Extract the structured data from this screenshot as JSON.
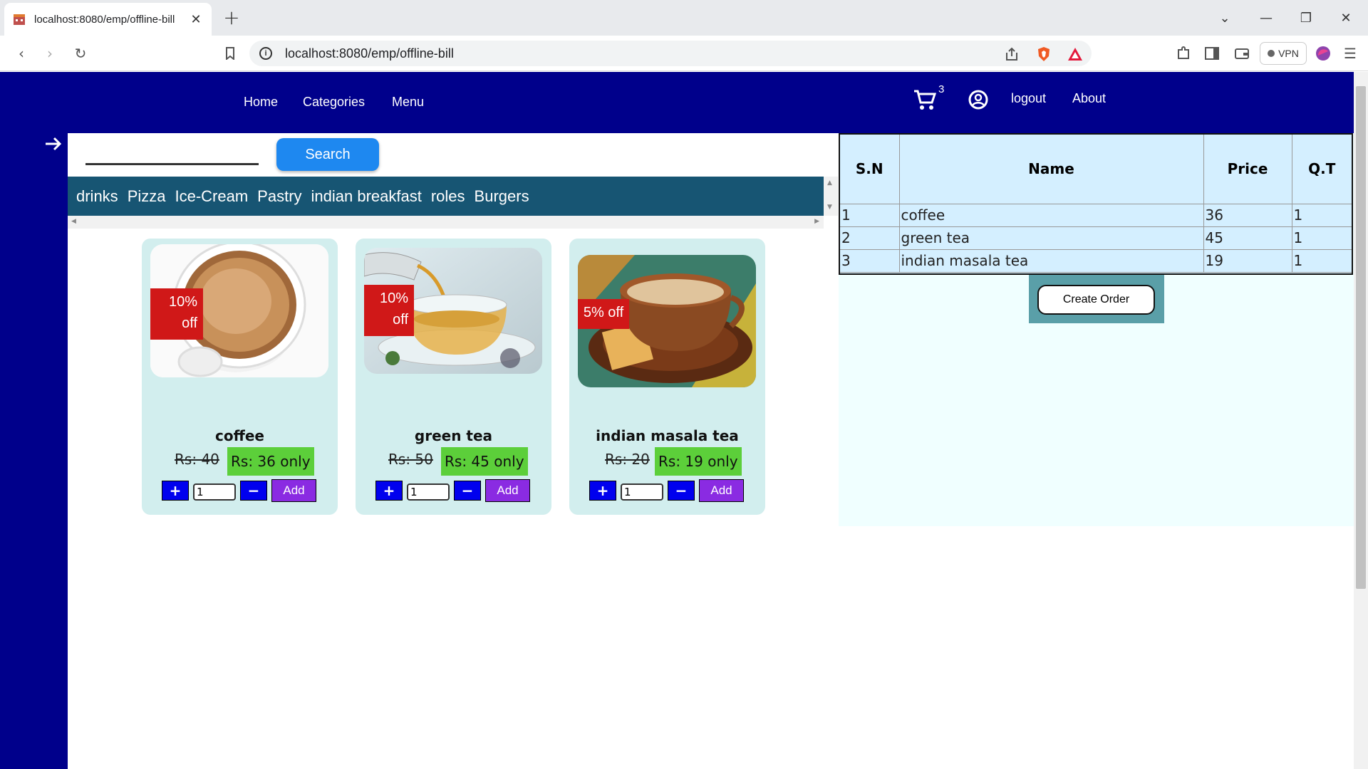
{
  "browser": {
    "tab_title": "localhost:8080/emp/offline-bill",
    "url": "localhost:8080/emp/offline-bill",
    "vpn_label": "VPN"
  },
  "nav": {
    "links": [
      "Home",
      "Categories",
      "Menu"
    ],
    "cart_count": "3",
    "logout": "logout",
    "about": "About"
  },
  "search": {
    "placeholder": "",
    "button": "Search"
  },
  "categories": [
    "drinks",
    "Pizza",
    "Ice-Cream",
    "Pastry",
    "indian breakfast",
    "roles",
    "Burgers"
  ],
  "products": [
    {
      "name": "coffee",
      "discount": "10% off",
      "old_price": "Rs: 40",
      "new_price": "Rs: 36 only",
      "qty": "1",
      "add": "Add",
      "plus": "+",
      "minus": "−"
    },
    {
      "name": "green tea",
      "discount": "10% off",
      "old_price": "Rs: 50",
      "new_price": "Rs: 45 only",
      "qty": "1",
      "add": "Add",
      "plus": "+",
      "minus": "−"
    },
    {
      "name": "indian masala tea",
      "discount": "5% off",
      "old_price": "Rs: 20",
      "new_price": "Rs: 19 only",
      "qty": "1",
      "add": "Add",
      "plus": "+",
      "minus": "−"
    }
  ],
  "bill": {
    "headers": [
      "S.N",
      "Name",
      "Price",
      "Q.T"
    ],
    "rows": [
      [
        "1",
        "coffee",
        "36",
        "1"
      ],
      [
        "2",
        "green tea",
        "45",
        "1"
      ],
      [
        "3",
        "indian masala tea",
        "19",
        "1"
      ]
    ],
    "create_order": "Create Order"
  },
  "colors": {
    "nav_bg": "#00008b",
    "category_bar": "#175573",
    "card_bg": "#d2eeee",
    "price_badge": "#5ccf3a",
    "discount_badge": "#d01818",
    "add_button": "#8a2be2",
    "bill_bg": "#d4efff"
  }
}
